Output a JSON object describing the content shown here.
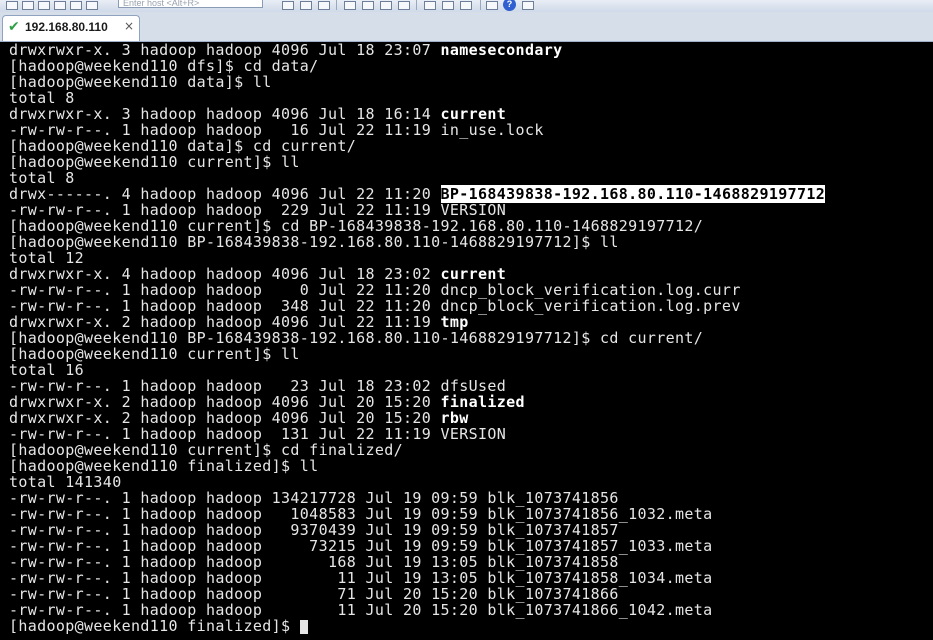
{
  "toolbar": {
    "address_placeholder": "Enter host <Alt+R>"
  },
  "tab": {
    "title": "192.168.80.110",
    "close": "×"
  },
  "terminal": {
    "lines": [
      {
        "segments": [
          {
            "t": "drwxrwxr-x. 3 hadoop hadoop 4096 Jul 18 23:07 ",
            "s": ""
          },
          {
            "t": "namesecondary",
            "s": "b"
          }
        ]
      },
      {
        "segments": [
          {
            "t": "[hadoop@weekend110 dfs]$ cd data/",
            "s": ""
          }
        ]
      },
      {
        "segments": [
          {
            "t": "[hadoop@weekend110 data]$ ll",
            "s": ""
          }
        ]
      },
      {
        "segments": [
          {
            "t": "total 8",
            "s": ""
          }
        ]
      },
      {
        "segments": [
          {
            "t": "drwxrwxr-x. 3 hadoop hadoop 4096 Jul 18 16:14 ",
            "s": ""
          },
          {
            "t": "current",
            "s": "b"
          }
        ]
      },
      {
        "segments": [
          {
            "t": "-rw-rw-r--. 1 hadoop hadoop   16 Jul 22 11:19 in_use.lock",
            "s": ""
          }
        ]
      },
      {
        "segments": [
          {
            "t": "[hadoop@weekend110 data]$ cd current/",
            "s": ""
          }
        ]
      },
      {
        "segments": [
          {
            "t": "[hadoop@weekend110 current]$ ll",
            "s": ""
          }
        ]
      },
      {
        "segments": [
          {
            "t": "total 8",
            "s": ""
          }
        ]
      },
      {
        "segments": [
          {
            "t": "drwx------. 4 hadoop hadoop 4096 Jul 22 11:20 ",
            "s": ""
          },
          {
            "t": "BP-168439838-192.168.80.110-1468829197712",
            "s": "hl"
          }
        ]
      },
      {
        "segments": [
          {
            "t": "-rw-rw-r--. 1 hadoop hadoop  229 Jul 22 11:19 VERSION",
            "s": ""
          }
        ]
      },
      {
        "segments": [
          {
            "t": "[hadoop@weekend110 current]$ cd BP-168439838-192.168.80.110-1468829197712/",
            "s": ""
          }
        ]
      },
      {
        "segments": [
          {
            "t": "[hadoop@weekend110 BP-168439838-192.168.80.110-1468829197712]$ ll",
            "s": ""
          }
        ]
      },
      {
        "segments": [
          {
            "t": "total 12",
            "s": ""
          }
        ]
      },
      {
        "segments": [
          {
            "t": "drwxrwxr-x. 4 hadoop hadoop 4096 Jul 18 23:02 ",
            "s": ""
          },
          {
            "t": "current",
            "s": "b"
          }
        ]
      },
      {
        "segments": [
          {
            "t": "-rw-rw-r--. 1 hadoop hadoop    0 Jul 22 11:20 dncp_block_verification.log.curr",
            "s": ""
          }
        ]
      },
      {
        "segments": [
          {
            "t": "-rw-rw-r--. 1 hadoop hadoop  348 Jul 22 11:20 dncp_block_verification.log.prev",
            "s": ""
          }
        ]
      },
      {
        "segments": [
          {
            "t": "drwxrwxr-x. 2 hadoop hadoop 4096 Jul 22 11:19 ",
            "s": ""
          },
          {
            "t": "tmp",
            "s": "b"
          }
        ]
      },
      {
        "segments": [
          {
            "t": "[hadoop@weekend110 BP-168439838-192.168.80.110-1468829197712]$ cd current/",
            "s": ""
          }
        ]
      },
      {
        "segments": [
          {
            "t": "[hadoop@weekend110 current]$ ll",
            "s": ""
          }
        ]
      },
      {
        "segments": [
          {
            "t": "total 16",
            "s": ""
          }
        ]
      },
      {
        "segments": [
          {
            "t": "-rw-rw-r--. 1 hadoop hadoop   23 Jul 18 23:02 dfsUsed",
            "s": ""
          }
        ]
      },
      {
        "segments": [
          {
            "t": "drwxrwxr-x. 2 hadoop hadoop 4096 Jul 20 15:20 ",
            "s": ""
          },
          {
            "t": "finalized",
            "s": "b"
          }
        ]
      },
      {
        "segments": [
          {
            "t": "drwxrwxr-x. 2 hadoop hadoop 4096 Jul 20 15:20 ",
            "s": ""
          },
          {
            "t": "rbw",
            "s": "b"
          }
        ]
      },
      {
        "segments": [
          {
            "t": "-rw-rw-r--. 1 hadoop hadoop  131 Jul 22 11:19 VERSION",
            "s": ""
          }
        ]
      },
      {
        "segments": [
          {
            "t": "[hadoop@weekend110 current]$ cd finalized/",
            "s": ""
          }
        ]
      },
      {
        "segments": [
          {
            "t": "[hadoop@weekend110 finalized]$ ll",
            "s": ""
          }
        ]
      },
      {
        "segments": [
          {
            "t": "total 141340",
            "s": ""
          }
        ]
      },
      {
        "segments": [
          {
            "t": "-rw-rw-r--. 1 hadoop hadoop 134217728 Jul 19 09:59 blk_1073741856",
            "s": ""
          }
        ]
      },
      {
        "segments": [
          {
            "t": "-rw-rw-r--. 1 hadoop hadoop   1048583 Jul 19 09:59 blk_1073741856_1032.meta",
            "s": ""
          }
        ]
      },
      {
        "segments": [
          {
            "t": "-rw-rw-r--. 1 hadoop hadoop   9370439 Jul 19 09:59 blk_1073741857",
            "s": ""
          }
        ]
      },
      {
        "segments": [
          {
            "t": "-rw-rw-r--. 1 hadoop hadoop     73215 Jul 19 09:59 blk_1073741857_1033.meta",
            "s": ""
          }
        ]
      },
      {
        "segments": [
          {
            "t": "-rw-rw-r--. 1 hadoop hadoop       168 Jul 19 13:05 blk_1073741858",
            "s": ""
          }
        ]
      },
      {
        "segments": [
          {
            "t": "-rw-rw-r--. 1 hadoop hadoop        11 Jul 19 13:05 blk_1073741858_1034.meta",
            "s": ""
          }
        ]
      },
      {
        "segments": [
          {
            "t": "-rw-rw-r--. 1 hadoop hadoop        71 Jul 20 15:20 blk_1073741866",
            "s": ""
          }
        ]
      },
      {
        "segments": [
          {
            "t": "-rw-rw-r--. 1 hadoop hadoop        11 Jul 20 15:20 blk_1073741866_1042.meta",
            "s": ""
          }
        ]
      },
      {
        "segments": [
          {
            "t": "[hadoop@weekend110 finalized]$ ",
            "s": ""
          }
        ],
        "cursor": true
      }
    ]
  },
  "colors": {
    "terminal_bg": "#000000",
    "terminal_fg": "#e6e6e6",
    "success_check": "#2ea043"
  }
}
